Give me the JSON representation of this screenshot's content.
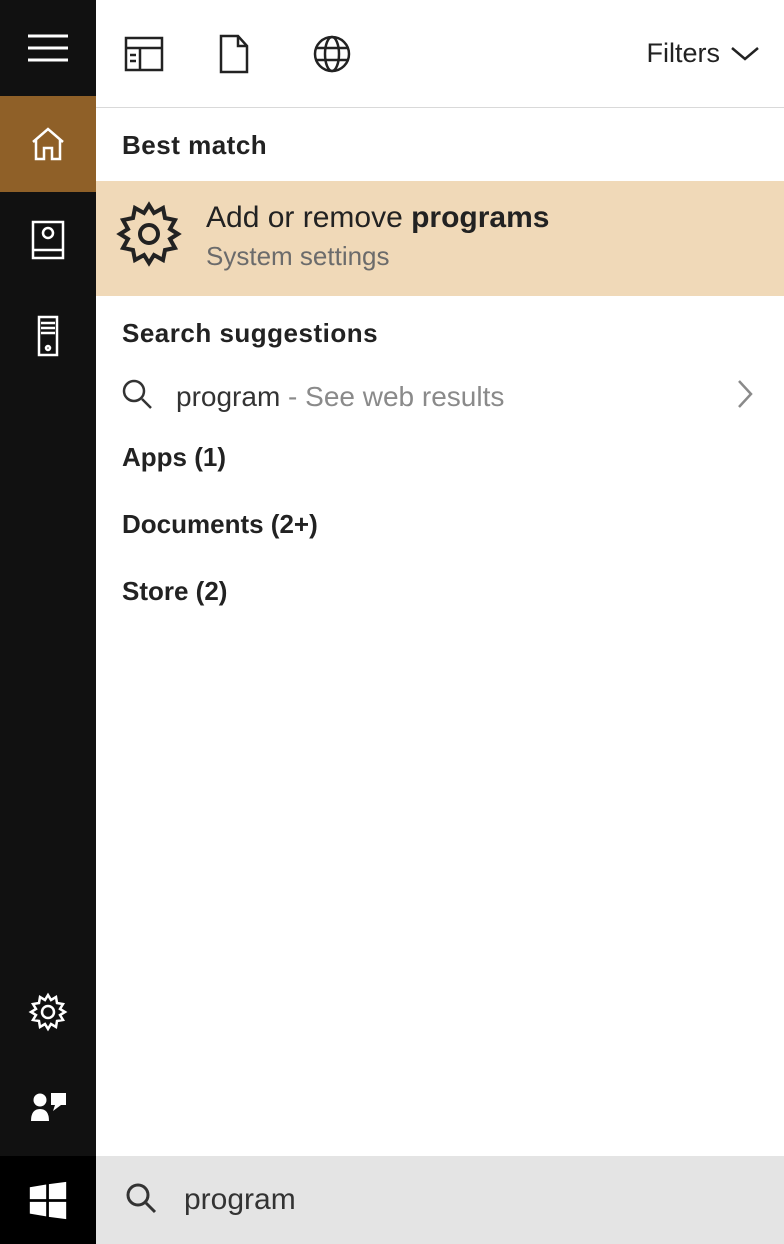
{
  "toolbar": {
    "filters_label": "Filters"
  },
  "headings": {
    "best_match": "Best match",
    "search_suggestions": "Search suggestions"
  },
  "best_match": {
    "title_prefix": "Add or remove ",
    "title_bold": "programs",
    "subtitle": "System settings"
  },
  "suggestion": {
    "term": "program",
    "separator": " - ",
    "hint": "See web results"
  },
  "categories": {
    "apps": "Apps (1)",
    "documents": "Documents (2+)",
    "store": "Store (2)"
  },
  "search": {
    "value": "program"
  }
}
